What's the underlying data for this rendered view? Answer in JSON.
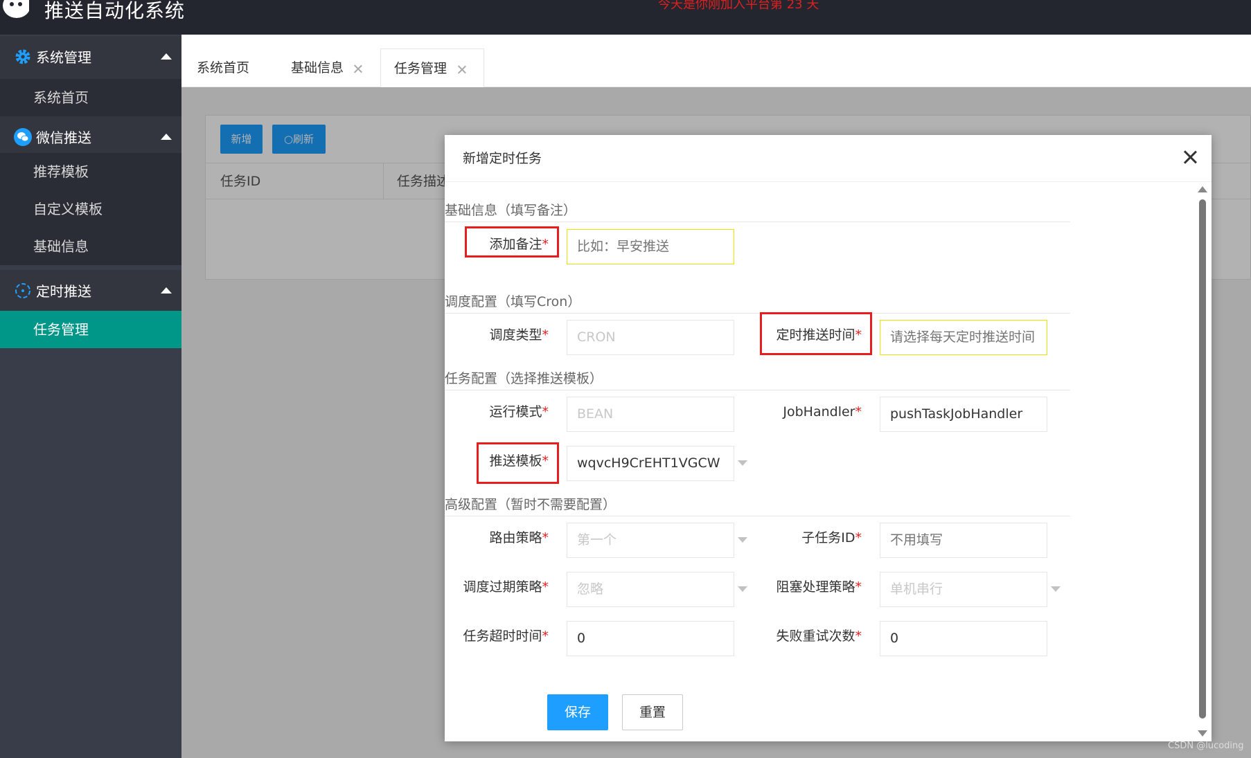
{
  "header": {
    "title": "推送自动化系统",
    "notice": "今天是你刚加入平台第 23 天"
  },
  "sidebar": {
    "groups": [
      {
        "label": "系统管理",
        "icon": "gear-icon",
        "items": [
          "系统首页"
        ]
      },
      {
        "label": "微信推送",
        "icon": "wechat-icon",
        "items": [
          "推荐模板",
          "自定义模板",
          "基础信息"
        ]
      },
      {
        "label": "定时推送",
        "icon": "timer-icon",
        "items": [
          "任务管理"
        ]
      }
    ],
    "active_item": "任务管理",
    "active_color": "#009688"
  },
  "tabs": [
    {
      "label": "系统首页",
      "closable": false
    },
    {
      "label": "基础信息",
      "closable": true
    },
    {
      "label": "任务管理",
      "closable": true,
      "active": true
    }
  ],
  "toolbar": {
    "add_label": "新增",
    "refresh_label": "○刷新"
  },
  "table": {
    "columns": [
      "任务ID",
      "任务描述"
    ]
  },
  "modal": {
    "title": "新增定时任务",
    "sections": {
      "basic": "基础信息（填写备注）",
      "schedule": "调度配置（填写Cron）",
      "task": "任务配置（选择推送模板）",
      "advanced": "高级配置（暂时不需要配置）"
    },
    "fields": {
      "remark": {
        "label": "添加备注",
        "placeholder": "比如：早安推送"
      },
      "schedule_type": {
        "label": "调度类型",
        "value": "CRON"
      },
      "push_time": {
        "label": "定时推送时间",
        "placeholder": "请选择每天定时推送时间"
      },
      "run_mode": {
        "label": "运行模式",
        "value": "BEAN"
      },
      "job_handler": {
        "label": "JobHandler",
        "value": "pushTaskJobHandler"
      },
      "template": {
        "label": "推送模板",
        "value": "wqvcH9CrEHT1VGCW"
      },
      "route": {
        "label": "路由策略",
        "value": "第一个"
      },
      "child_task": {
        "label": "子任务ID",
        "placeholder": "不用填写"
      },
      "misfire": {
        "label": "调度过期策略",
        "value": "忽略"
      },
      "block": {
        "label": "阻塞处理策略",
        "value": "单机串行"
      },
      "timeout": {
        "label": "任务超时时间",
        "value": "0"
      },
      "retry": {
        "label": "失败重试次数",
        "value": "0"
      }
    },
    "required_mark": "*",
    "save_label": "保存",
    "reset_label": "重置"
  },
  "watermark": "CSDN @lucoding",
  "colors": {
    "primary": "#1e9fff",
    "highlight": "#e81d1d",
    "header_bg": "#23262e",
    "sidebar_bg": "#393d49"
  }
}
